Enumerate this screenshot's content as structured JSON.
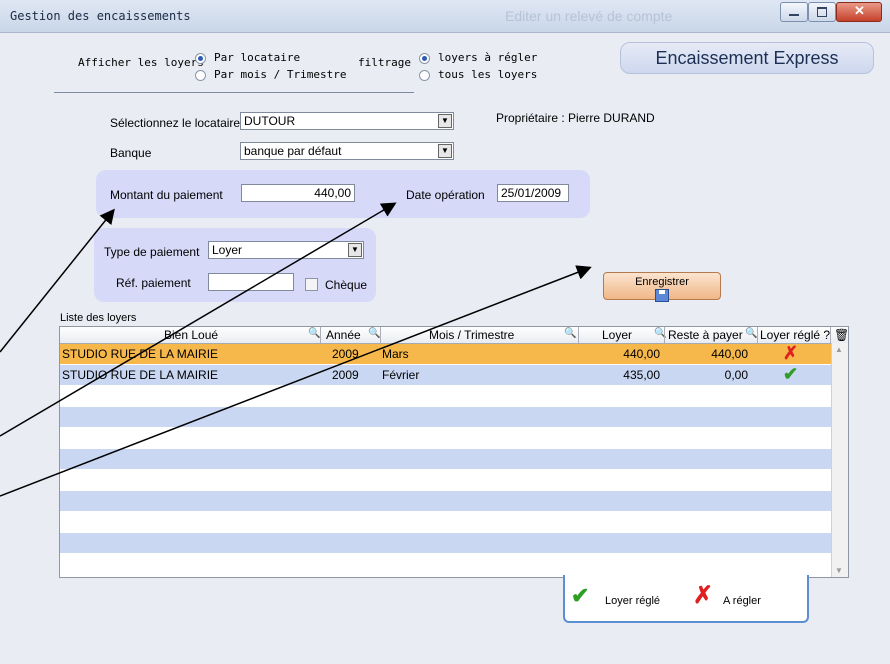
{
  "window": {
    "title": "Gestion des encaissements",
    "ghost_title": "Editer un relevé de compte"
  },
  "filters": {
    "afficher_label": "Afficher les loyers",
    "afficher_options": [
      "Par locataire",
      "Par mois / Trimestre"
    ],
    "afficher_selected": "Par locataire",
    "filtrage_label": "filtrage",
    "filtrage_options": [
      "loyers à régler",
      "tous les loyers"
    ],
    "filtrage_selected": "loyers à régler"
  },
  "express_button": "Encaissement Express",
  "form": {
    "locataire_label": "Sélectionnez le locataire",
    "locataire_value": "DUTOUR",
    "proprietaire": "Propriétaire : Pierre DURAND",
    "banque_label": "Banque",
    "banque_value": "banque par défaut",
    "montant_label": "Montant du paiement",
    "montant_value": "440,00",
    "date_label": "Date opération",
    "date_value": "25/01/2009",
    "type_label": "Type de paiement",
    "type_value": "Loyer",
    "ref_label": "Réf. paiement",
    "ref_value": "",
    "cheque_label": "Chèque",
    "cheque_checked": false
  },
  "save_button": "Enregistrer",
  "list": {
    "title": "Liste des loyers",
    "columns": [
      "Bien Loué",
      "Année",
      "Mois / Trimestre",
      "Loyer",
      "Reste à payer",
      "Loyer réglé ?"
    ],
    "rows": [
      {
        "bien": "STUDIO RUE DE LA MAIRIE",
        "annee": "2009",
        "mois": "Mars",
        "loyer": "440,00",
        "reste": "440,00",
        "regle": "cross-icon",
        "selected": true
      },
      {
        "bien": "STUDIO RUE DE LA MAIRIE",
        "annee": "2009",
        "mois": "Février",
        "loyer": "435,00",
        "reste": "0,00",
        "regle": "check-icon",
        "selected": false
      }
    ]
  },
  "legend": {
    "paid_label": "Loyer réglé",
    "unpaid_label": "A régler"
  },
  "colors": {
    "selected_row": "#f7b84b",
    "stripe": "#c9d7f2",
    "panel": "#d6d9f8",
    "check": "#2f9e24",
    "cross": "#e02020"
  }
}
